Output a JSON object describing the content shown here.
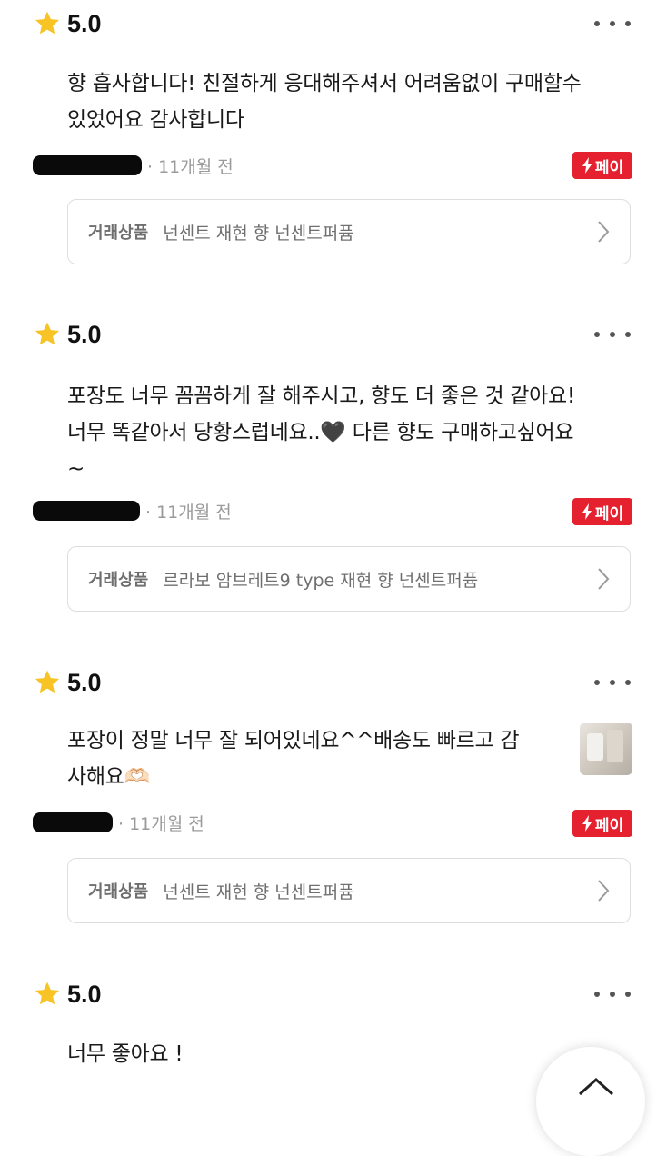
{
  "reviews": [
    {
      "score": "5.0",
      "text": "향 흡사합니다! 친절하게 응대해주셔서 어려움없이 구매할수\n있었어요 감사합니다",
      "time": "· 11개월 전",
      "pay_label": "페이",
      "product_label": "거래상품",
      "product_name": "넌센트 재현 향 넌센트퍼퓸"
    },
    {
      "score": "5.0",
      "text": "포장도 너무 꼼꼼하게 잘 해주시고, 향도 더 좋은 것 같아요!\n너무 똑같아서 당황스럽네요..🖤 다른 향도 구매하고싶어요\n~",
      "time": "· 11개월 전",
      "pay_label": "페이",
      "product_label": "거래상품",
      "product_name": "르라보 암브레트9 type 재현 향 넌센트퍼퓸"
    },
    {
      "score": "5.0",
      "text": "포장이 정말 너무 잘 되어있네요^^배송도 빠르고 감\n사해요🫶🏻",
      "time": "· 11개월 전",
      "pay_label": "페이",
      "product_label": "거래상품",
      "product_name": "넌센트 재현 향 넌센트퍼퓸"
    },
    {
      "score": "5.0",
      "text": "너무 좋아요 !"
    }
  ],
  "icons": {
    "rating": "star-icon",
    "more": "more-horizontal-icon",
    "pay": "lightning-icon",
    "product": "chevron-right-icon",
    "scroll_top": "chevron-up-icon"
  },
  "colors": {
    "star": "#f7c325",
    "pay_badge": "#e5202f",
    "muted_text": "#9a9a9a"
  }
}
